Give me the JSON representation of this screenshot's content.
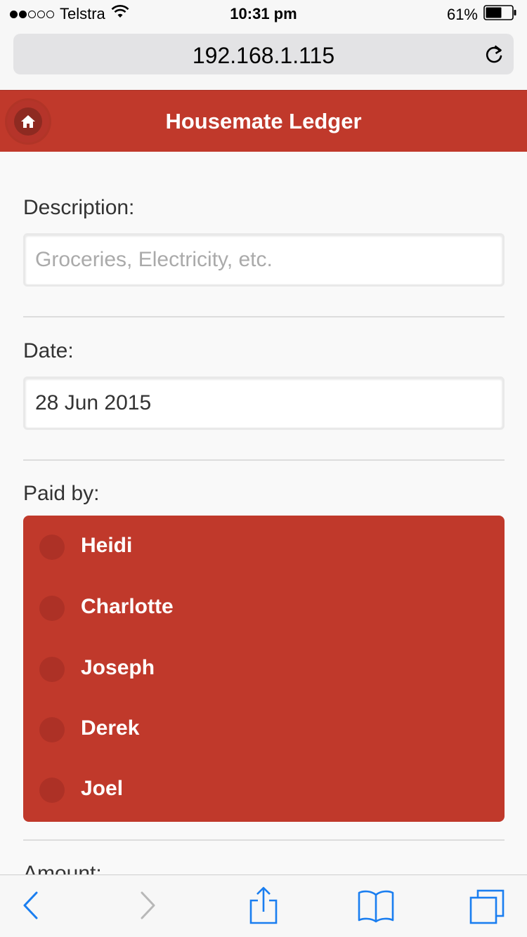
{
  "status_bar": {
    "carrier": "Telstra",
    "signal_bars_filled": 2,
    "signal_bars_total": 5,
    "time": "10:31 pm",
    "battery_percent_label": "61%",
    "battery_level": 0.61
  },
  "browser": {
    "url": "192.168.1.115",
    "reload_icon": "reload-icon"
  },
  "header": {
    "title": "Housemate Ledger",
    "home_icon": "home-icon"
  },
  "form": {
    "description": {
      "label": "Description:",
      "placeholder": "Groceries, Electricity, etc.",
      "value": ""
    },
    "date": {
      "label": "Date:",
      "value": "28 Jun 2015"
    },
    "paid_by": {
      "label": "Paid by:",
      "options": [
        "Heidi",
        "Charlotte",
        "Joseph",
        "Derek",
        "Joel"
      ]
    },
    "amount": {
      "label": "Amount:"
    }
  },
  "toolbar": {
    "icons": [
      "back-icon",
      "forward-icon",
      "share-icon",
      "bookmarks-icon",
      "tabs-icon"
    ]
  },
  "colors": {
    "accent": "#c0392b",
    "ios_blue": "#1a7ef0",
    "disabled_gray": "#b8b8b8"
  }
}
